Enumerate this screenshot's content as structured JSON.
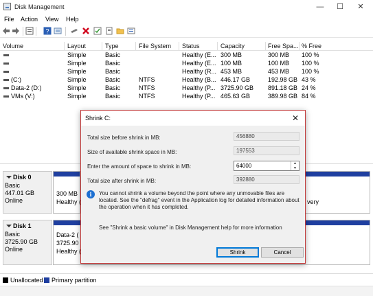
{
  "window": {
    "title": "Disk Management",
    "controls": {
      "minimize": "—",
      "maximize": "☐",
      "close": "✕"
    }
  },
  "menu": [
    "File",
    "Action",
    "View",
    "Help"
  ],
  "toolbar": {
    "icons": [
      "back-icon",
      "forward-icon",
      "properties-icon",
      "help-icon",
      "refresh-icon",
      "connect-icon",
      "delete-icon",
      "check-icon",
      "open-icon",
      "folder-icon",
      "list-icon"
    ],
    "delete_color": "#d0021b"
  },
  "volume_list": {
    "columns": [
      "Volume",
      "Layout",
      "Type",
      "File System",
      "Status",
      "Capacity",
      "Free Spa...",
      "% Free"
    ],
    "rows": [
      {
        "volume": "",
        "layout": "Simple",
        "type": "Basic",
        "fs": "",
        "status": "Healthy (E...",
        "capacity": "300 MB",
        "free": "300 MB",
        "pct": "100 %"
      },
      {
        "volume": "",
        "layout": "Simple",
        "type": "Basic",
        "fs": "",
        "status": "Healthy (E...",
        "capacity": "100 MB",
        "free": "100 MB",
        "pct": "100 %"
      },
      {
        "volume": "",
        "layout": "Simple",
        "type": "Basic",
        "fs": "",
        "status": "Healthy (R...",
        "capacity": "453 MB",
        "free": "453 MB",
        "pct": "100 %"
      },
      {
        "volume": "(C:)",
        "layout": "Simple",
        "type": "Basic",
        "fs": "NTFS",
        "status": "Healthy (B...",
        "capacity": "446.17 GB",
        "free": "192.98 GB",
        "pct": "43 %"
      },
      {
        "volume": "Data-2 (D:)",
        "layout": "Simple",
        "type": "Basic",
        "fs": "NTFS",
        "status": "Healthy (P...",
        "capacity": "3725.90 GB",
        "free": "891.18 GB",
        "pct": "24 %"
      },
      {
        "volume": "VMs (V:)",
        "layout": "Simple",
        "type": "Basic",
        "fs": "NTFS",
        "status": "Healthy (P...",
        "capacity": "465.63 GB",
        "free": "389.98 GB",
        "pct": "84 %"
      }
    ]
  },
  "disks": [
    {
      "name": "Disk 0",
      "type": "Basic",
      "size": "447.01 GB",
      "status": "Online",
      "partition": {
        "line1": "300 MB",
        "line2": "Healthy ("
      },
      "right_text": "very"
    },
    {
      "name": "Disk 1",
      "type": "Basic",
      "size": "3725.90 GB",
      "status": "Online",
      "partition": {
        "line1": "Data-2 (",
        "line2": "3725.90 G",
        "line3": "Healthy ("
      }
    }
  ],
  "legend": [
    {
      "label": "Unallocated",
      "color": "#000000"
    },
    {
      "label": "Primary partition",
      "color": "#1f3fa0"
    }
  ],
  "dialog": {
    "title": "Shrink C:",
    "fields": {
      "total_before_label": "Total size before shrink in MB:",
      "total_before_value": "456880",
      "available_label": "Size of available shrink space in MB:",
      "available_value": "197553",
      "amount_label": "Enter the amount of space to shrink in MB:",
      "amount_value": "64000",
      "after_label": "Total size after shrink in MB:",
      "after_value": "392880"
    },
    "info": "You cannot shrink a volume beyond the point where any unmovable files are located. See the \"defrag\" event in the Application log for detailed information about the operation when it has completed.",
    "help": "See \"Shrink a basic volume\" in Disk Management help for more information",
    "buttons": {
      "shrink": "Shrink",
      "cancel": "Cancel"
    }
  }
}
